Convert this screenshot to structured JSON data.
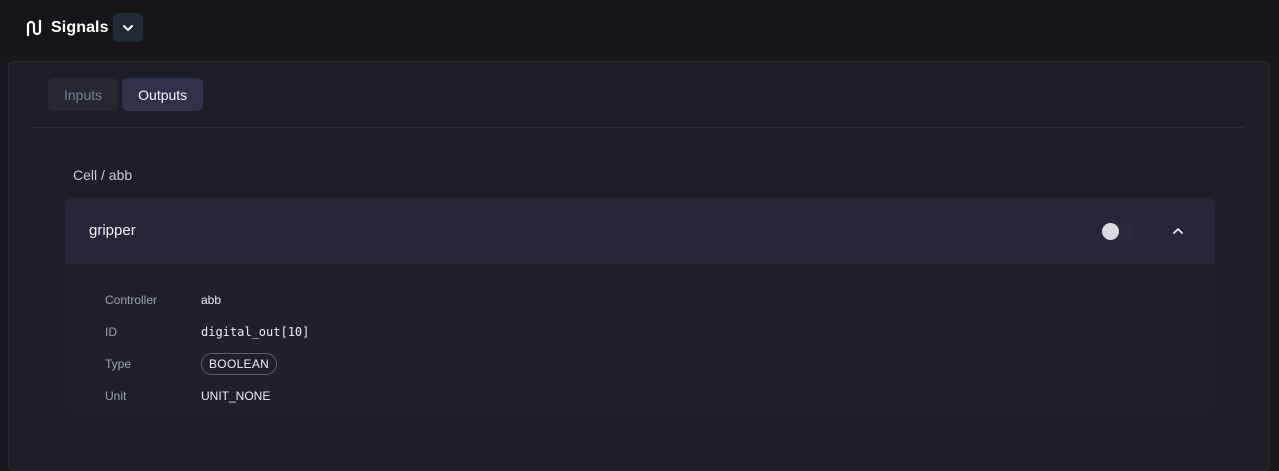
{
  "header": {
    "title": "Signals",
    "logo_icon": "signal-wave-icon",
    "dropdown_icon": "chevron-down-icon"
  },
  "tabs": [
    {
      "label": "Inputs",
      "active": false
    },
    {
      "label": "Outputs",
      "active": true
    }
  ],
  "group": {
    "label": "Cell / abb"
  },
  "signal": {
    "name": "gripper",
    "toggle_on": false,
    "expanded": true,
    "details": [
      {
        "key": "Controller",
        "value": "abb",
        "style": "text"
      },
      {
        "key": "ID",
        "value": "digital_out[10]",
        "style": "mono"
      },
      {
        "key": "Type",
        "value": "BOOLEAN",
        "style": "badge"
      },
      {
        "key": "Unit",
        "value": "UNIT_NONE",
        "style": "text"
      }
    ]
  },
  "colors": {
    "background": "#17171d",
    "panel": "#1e1e28",
    "card_header": "#262638",
    "tab_active": "#30324a"
  }
}
